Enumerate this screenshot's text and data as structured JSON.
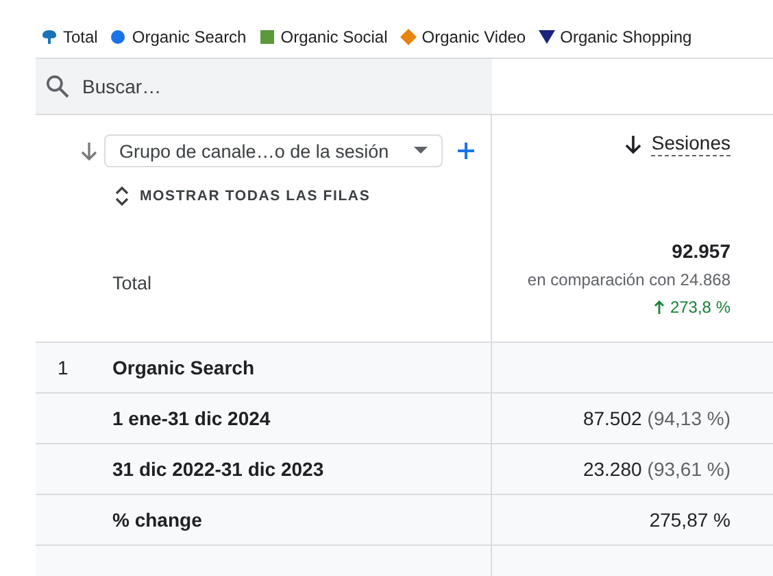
{
  "legend": [
    {
      "label": "Total",
      "kind": "pin",
      "color": "#1a73b8"
    },
    {
      "label": "Organic Search",
      "kind": "circle",
      "color": "#1a73e8"
    },
    {
      "label": "Organic Social",
      "kind": "square",
      "color": "#5a9a3a"
    },
    {
      "label": "Organic Video",
      "kind": "diamond",
      "color": "#e8830c"
    },
    {
      "label": "Organic Shopping",
      "kind": "triangle",
      "color": "#1c237e"
    }
  ],
  "search": {
    "placeholder": "Buscar…"
  },
  "dimension": {
    "label": "Grupo de canale…o de la sesión",
    "show_all": "MOSTRAR TODAS LAS FILAS"
  },
  "metric": {
    "label": "Sesiones"
  },
  "total": {
    "label": "Total",
    "value": "92.957",
    "comparison": "en comparación con 24.868",
    "change": "273,8 %"
  },
  "rows": [
    {
      "kind": "group",
      "index": "1",
      "label": "Organic Search"
    },
    {
      "kind": "period",
      "label": "1 ene-31 dic 2024",
      "value": "87.502",
      "share": "(94,13 %)"
    },
    {
      "kind": "period",
      "label": "31 dic 2022-31 dic 2023",
      "value": "23.280",
      "share": "(93,61 %)"
    },
    {
      "kind": "change",
      "label": "% change",
      "value": "275,87 %"
    }
  ]
}
